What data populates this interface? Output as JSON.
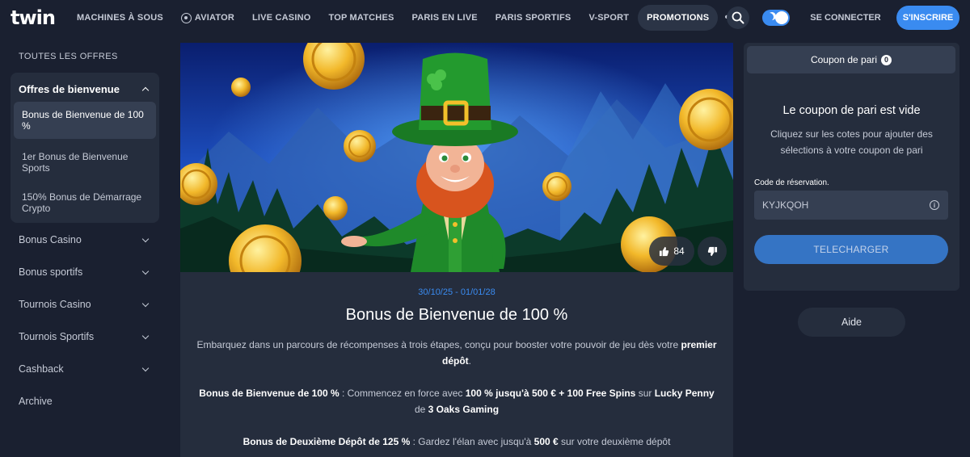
{
  "header": {
    "logo": "twin",
    "nav": [
      "MACHINES À SOUS",
      "AVIATOR",
      "LIVE CASINO",
      "TOP MATCHES",
      "PARIS EN LIVE",
      "PARIS SPORTIFS",
      "V-SPORT",
      "PROMOTIONS"
    ],
    "active_nav": "PROMOTIONS",
    "more_icon": "more-dots-icon",
    "search_icon": "search-icon",
    "theme_toggle": "on",
    "login_label": "SE CONNECTER",
    "signup_label": "S'INSCRIRE"
  },
  "sidebar": {
    "title": "TOUTES LES OFFRES",
    "open_group": {
      "label": "Offres de bienvenue",
      "items": [
        "Bonus de Bienvenue de 100 %",
        "1er Bonus de Bienvenue Sports",
        "150% Bonus de Démarrage Crypto"
      ],
      "active_index": 0
    },
    "links": [
      "Bonus Casino",
      "Bonus sportifs",
      "Tournois Casino",
      "Tournois Sportifs",
      "Cashback",
      "Archive"
    ]
  },
  "promo": {
    "likes": "84",
    "dates": "30/10/25 - 01/01/28",
    "title": "Bonus de Bienvenue de 100 %",
    "intro_1": "Embarquez dans un parcours de récompenses à trois étapes, conçu pour booster votre pouvoir de jeu dès votre ",
    "intro_2": "premier dépôt",
    "intro_3": ".",
    "step1_a": "Bonus de Bienvenue de 100 %",
    "step1_b": " : Commencez en force avec ",
    "step1_c": "100 % jusqu'à 500 € + 100 Free Spins",
    "step1_d": " sur ",
    "step1_e": "Lucky Penny",
    "step1_f": " de ",
    "step1_g": "3 Oaks Gaming",
    "step2_a": "Bonus de Deuxième Dépôt de 125 %",
    "step2_b": " : Gardez l'élan avec jusqu'à ",
    "step2_c": "500 €",
    "step2_d": " sur votre deuxième dépôt"
  },
  "betslip": {
    "tab_label": "Coupon de pari",
    "count": "0",
    "empty_title": "Le coupon de pari est vide",
    "empty_desc": "Cliquez sur les cotes pour ajouter des sélections à votre coupon de pari",
    "code_label": "Code de réservation.",
    "code_value": "KYJKQOH",
    "download_label": "TELECHARGER",
    "help_label": "Aide"
  },
  "colors": {
    "accent": "#3a8bf0",
    "background": "#1a2030",
    "panel": "#252d3d"
  }
}
